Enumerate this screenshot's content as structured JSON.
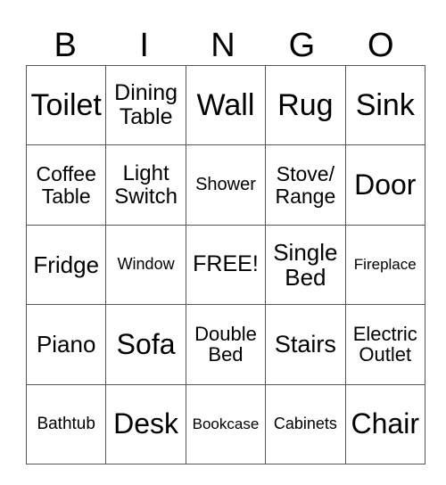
{
  "header": {
    "letters": [
      "B",
      "I",
      "N",
      "G",
      "O"
    ]
  },
  "grid": {
    "rows": [
      [
        "Toilet",
        "Dining Table",
        "Wall",
        "Rug",
        "Sink"
      ],
      [
        "Coffee Table",
        "Light Switch",
        "Shower",
        "Stove/ Range",
        "Door"
      ],
      [
        "Fridge",
        "Window",
        "FREE!",
        "Single Bed",
        "Fireplace"
      ],
      [
        "Piano",
        "Sofa",
        "Double Bed",
        "Stairs",
        "Electric Outlet"
      ],
      [
        "Bathtub",
        "Desk",
        "Bookcase",
        "Cabinets",
        "Chair"
      ]
    ]
  }
}
